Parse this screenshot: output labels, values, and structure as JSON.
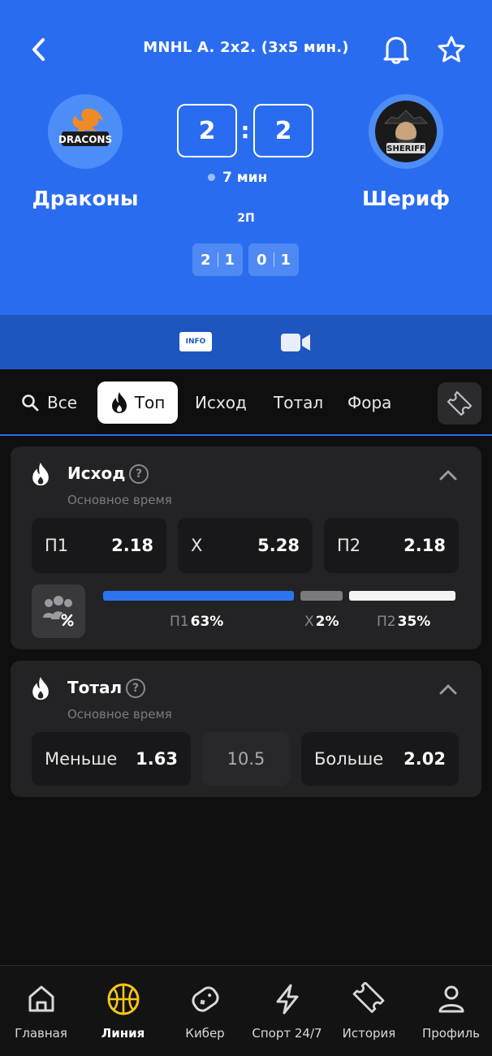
{
  "header": {
    "league": "MNHL A. 2x2. (3x5 мин.)",
    "team_home": {
      "name": "Драконы",
      "logo_text": "DRACONS"
    },
    "team_away": {
      "name": "Шериф",
      "logo_text": "SHERIFF"
    },
    "score_home": "2",
    "score_away": "2",
    "score_separator": ":",
    "time": "7 мин",
    "period": "2П",
    "period_scores": [
      {
        "home": "2",
        "away": "1"
      },
      {
        "home": "0",
        "away": "1"
      }
    ]
  },
  "media": {
    "info_label": "INFO"
  },
  "tabs": {
    "all": "Все",
    "top": "Топ",
    "outcome": "Исход",
    "total": "Тотал",
    "handicap": "Фора"
  },
  "markets": {
    "outcome": {
      "title": "Исход",
      "subtitle": "Основное время",
      "odds": [
        {
          "label": "П1",
          "value": "2.18"
        },
        {
          "label": "Х",
          "value": "5.28"
        },
        {
          "label": "П2",
          "value": "2.18"
        }
      ],
      "distribution": [
        {
          "label": "П1",
          "percent_text": "63%",
          "percent": 63
        },
        {
          "label": "Х",
          "percent_text": "2%",
          "percent": 2
        },
        {
          "label": "П2",
          "percent_text": "35%",
          "percent": 35
        }
      ]
    },
    "total": {
      "title": "Тотал",
      "subtitle": "Основное время",
      "under": {
        "label": "Меньше",
        "value": "1.63"
      },
      "line": "10.5",
      "over": {
        "label": "Больше",
        "value": "2.02"
      }
    }
  },
  "bottom_nav": [
    {
      "label": "Главная",
      "icon": "home-icon"
    },
    {
      "label": "Линия",
      "icon": "basketball-icon",
      "active": true
    },
    {
      "label": "Кибер",
      "icon": "gamepad-icon"
    },
    {
      "label": "Спорт 24/7",
      "icon": "lightning-icon"
    },
    {
      "label": "История",
      "icon": "ticket-icon"
    },
    {
      "label": "Профиль",
      "icon": "user-icon"
    }
  ],
  "colors": {
    "header_blue": "#2a6cf0",
    "accent_blue": "#2e74f0",
    "active_nav": "#f5c518",
    "card_bg": "#232325"
  }
}
